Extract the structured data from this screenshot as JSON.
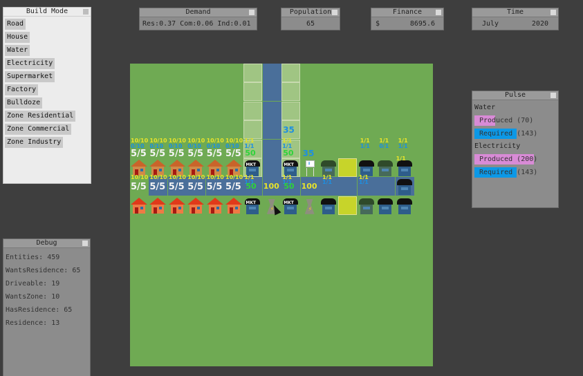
{
  "build_mode": {
    "title": "Build Mode",
    "items": [
      "Road",
      "House",
      "Water",
      "Electricity",
      "Supermarket",
      "Factory",
      "Bulldoze",
      "Zone Residential",
      "Zone Commercial",
      "Zone Industry"
    ]
  },
  "demand": {
    "title": "Demand",
    "value": "Res:0.37 Com:0.06 Ind:0.01"
  },
  "population": {
    "title": "Population",
    "value": "65"
  },
  "finance": {
    "title": "Finance",
    "currency": "$",
    "value": "8695.6"
  },
  "time": {
    "title": "Time",
    "month": "July",
    "year": "2020"
  },
  "pulse": {
    "title": "Pulse",
    "water": {
      "label": "Water",
      "produced_label": "Produced (70)",
      "required_label": "Required (143)",
      "produced": 70,
      "required": 143
    },
    "electricity": {
      "label": "Electricity",
      "produced_label": "Produced (200)",
      "required_label": "Required (143)",
      "produced": 200,
      "required": 143
    }
  },
  "debug": {
    "title": "Debug",
    "lines": [
      "Entities: 459",
      "WantsResidence: 65",
      "Driveable: 19",
      "WantsZone: 10",
      "HasResidence: 65",
      "Residence: 13"
    ]
  },
  "map": {
    "labels": {
      "water_cap": "10/10",
      "power_cap": "0/10",
      "occupancy": "5/5",
      "shop_water": "1/1",
      "shop_power": "1/1",
      "shop_power_empty": "0/1",
      "market_capacity": "50",
      "power_output": "100",
      "pump_output": "35",
      "market_sign": "MKT",
      "bolt": "⚡",
      "drop": "⬇"
    }
  },
  "colors": {
    "background": "#3e3e3e",
    "grass": "#6faa53",
    "road": "#4a6f9a",
    "produced": "#d88bd6",
    "required": "#0c98e6"
  }
}
